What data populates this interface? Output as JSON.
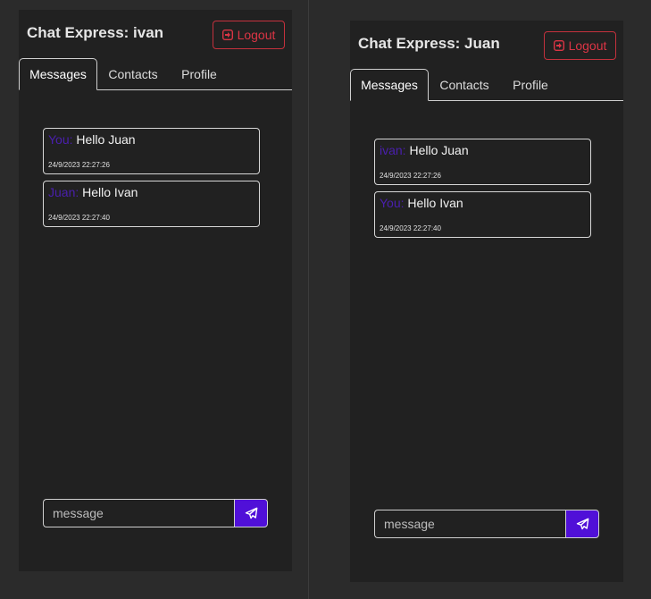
{
  "windows": [
    {
      "app_title": "Chat Express: ivan",
      "logout_label": "Logout",
      "tabs": [
        {
          "label": "Messages",
          "active": true
        },
        {
          "label": "Contacts",
          "active": false
        },
        {
          "label": "Profile",
          "active": false
        }
      ],
      "messages": [
        {
          "sender": "You:",
          "text": "Hello Juan",
          "time": "24/9/2023 22:27:26"
        },
        {
          "sender": "Juan:",
          "text": "Hello Ivan",
          "time": "24/9/2023 22:27:40"
        }
      ],
      "composer": {
        "placeholder": "message",
        "value": ""
      }
    },
    {
      "app_title": "Chat Express: Juan",
      "logout_label": "Logout",
      "tabs": [
        {
          "label": "Messages",
          "active": true
        },
        {
          "label": "Contacts",
          "active": false
        },
        {
          "label": "Profile",
          "active": false
        }
      ],
      "messages": [
        {
          "sender": "ivan:",
          "text": "Hello Juan",
          "time": "24/9/2023 22:27:26"
        },
        {
          "sender": "You:",
          "text": "Hello Ivan",
          "time": "24/9/2023 22:27:40"
        }
      ],
      "composer": {
        "placeholder": "message",
        "value": ""
      }
    }
  ],
  "colors": {
    "background": "#2b2b2b",
    "panel": "#212121",
    "danger": "#dc3545",
    "accent": "#5010d8",
    "sender_name": "#4a1fae"
  },
  "icons": {
    "logout": "sign-out-icon",
    "send": "paper-plane-icon"
  }
}
